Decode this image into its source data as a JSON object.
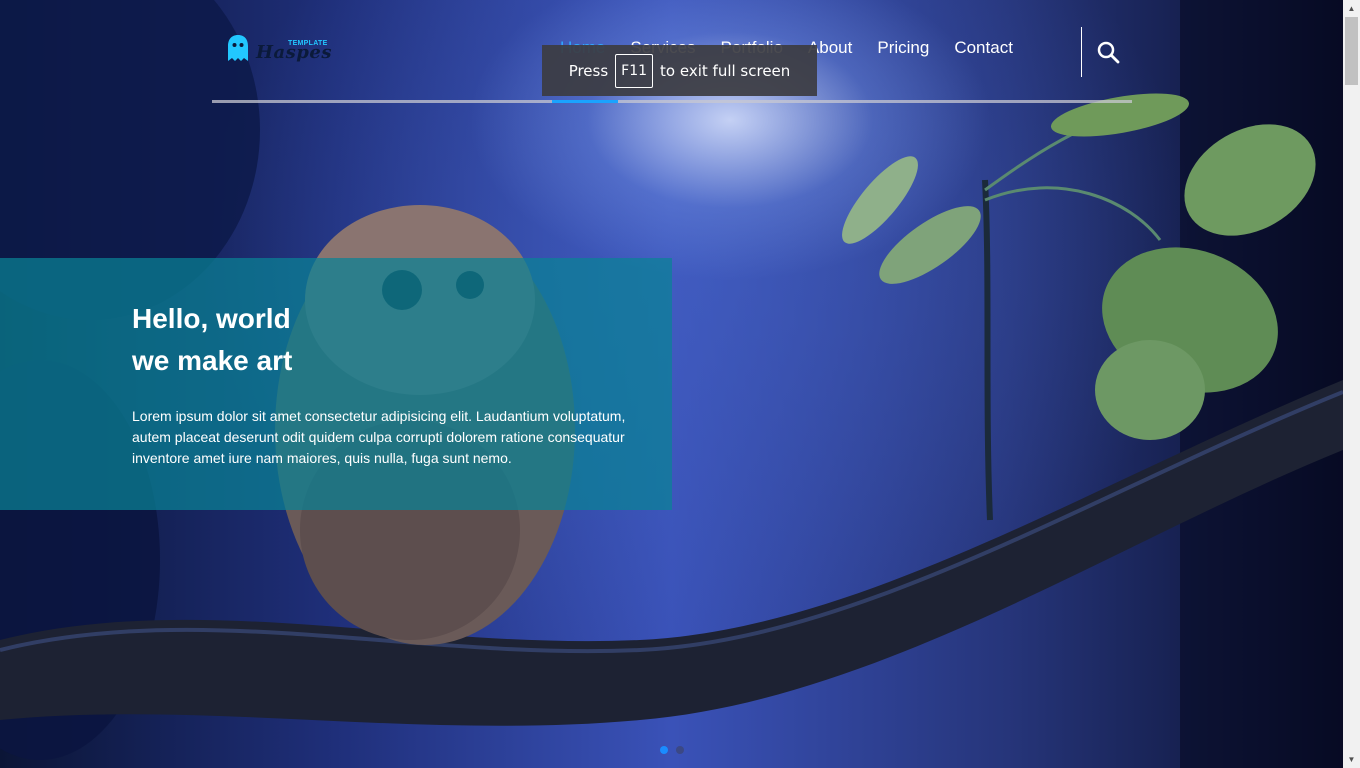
{
  "logo": {
    "text": "Haspes",
    "tag": "TEMPLATE"
  },
  "nav": {
    "items": [
      {
        "label": "Home",
        "active": true
      },
      {
        "label": "Services",
        "active": false
      },
      {
        "label": "Portfolio",
        "active": false
      },
      {
        "label": "About",
        "active": false
      },
      {
        "label": "Pricing",
        "active": false
      },
      {
        "label": "Contact",
        "active": false
      }
    ],
    "search_icon": "search-icon"
  },
  "fullscreen_notice": {
    "before": "Press",
    "key": "F11",
    "after": "to exit full screen"
  },
  "hero": {
    "title_line1": "Hello, world",
    "title_line2": "we make art",
    "text": "Lorem ipsum dolor sit amet consectetur adipisicing elit. Laudantium voluptatum, autem placeat deserunt odit quidem culpa corrupti dolorem ratione consequatur inventore amet iure nam maiores, quis nulla, fuga sunt nemo."
  },
  "slider": {
    "dots": 2,
    "active_index": 0
  },
  "colors": {
    "accent": "#1aa3ff",
    "panel": "#0a8296",
    "toast": "#3c3c41"
  }
}
